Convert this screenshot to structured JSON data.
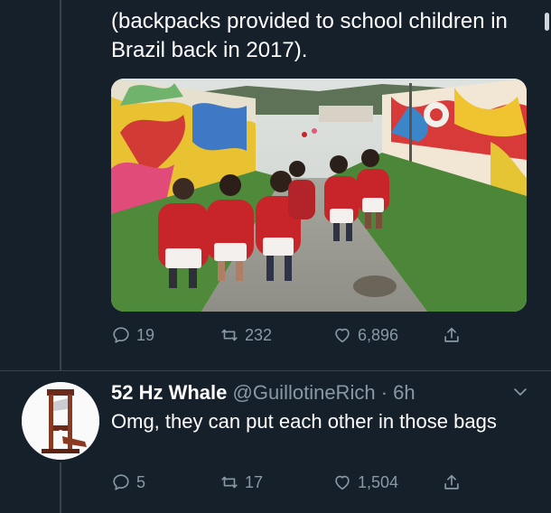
{
  "tweet": {
    "text": "(backpacks provided to school children in Brazil back in 2017).",
    "photo_icon": "photo-school-children-backpacks",
    "actions": {
      "replies": "19",
      "retweets": "232",
      "likes": "6,896"
    }
  },
  "reply": {
    "name": "52 Hz Whale",
    "handle": "@GuillotineRich",
    "separator": "·",
    "time": "6h",
    "text": "Omg, they can put each other in those bags",
    "actions": {
      "replies": "5",
      "retweets": "17",
      "likes": "1,504"
    }
  },
  "colors": {
    "background": "#15202b",
    "muted": "#8899a6",
    "line": "#38444d",
    "backpack": "#c8252b"
  },
  "icons": [
    "reply-icon",
    "retweet-icon",
    "like-icon",
    "share-icon",
    "chevron-down-icon",
    "guillotine-avatar"
  ]
}
